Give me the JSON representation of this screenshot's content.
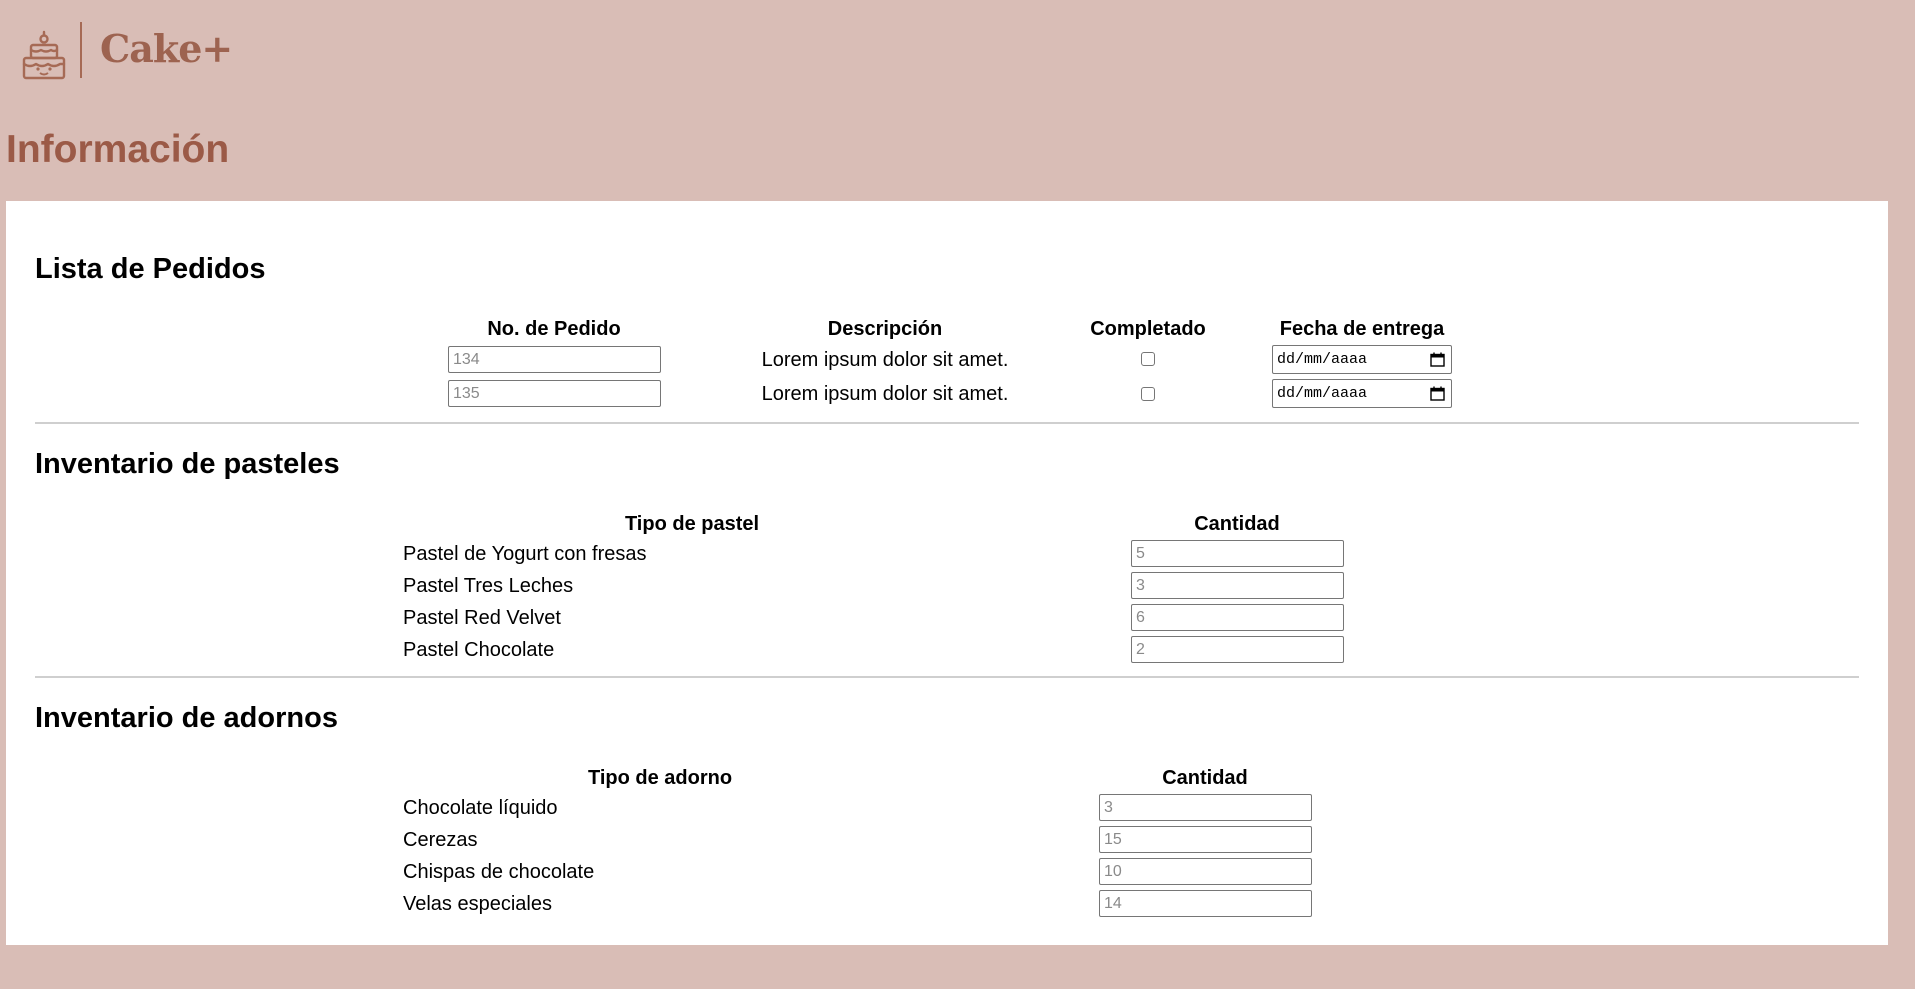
{
  "brand": {
    "name": "Cake+"
  },
  "page": {
    "title": "Información"
  },
  "orders": {
    "title": "Lista de Pedidos",
    "headers": [
      "No. de Pedido",
      "Descripción",
      "Completado",
      "Fecha de entrega"
    ],
    "rows": [
      {
        "number_placeholder": "134",
        "description": "Lorem ipsum dolor sit amet.",
        "completed": false,
        "date_placeholder": "dd/mm/aaaa"
      },
      {
        "number_placeholder": "135",
        "description": "Lorem ipsum dolor sit amet.",
        "completed": false,
        "date_placeholder": "dd/mm/aaaa"
      }
    ]
  },
  "cakes": {
    "title": "Inventario de pasteles",
    "headers": [
      "Tipo de pastel",
      "Cantidad"
    ],
    "rows": [
      {
        "name": "Pastel de Yogurt con fresas",
        "qty_placeholder": "5"
      },
      {
        "name": "Pastel Tres Leches",
        "qty_placeholder": "3"
      },
      {
        "name": "Pastel Red Velvet",
        "qty_placeholder": "6"
      },
      {
        "name": "Pastel Chocolate",
        "qty_placeholder": "2"
      }
    ]
  },
  "decorations": {
    "title": "Inventario de adornos",
    "headers": [
      "Tipo de adorno",
      "Cantidad"
    ],
    "rows": [
      {
        "name": "Chocolate líquido",
        "qty_placeholder": "3"
      },
      {
        "name": "Cerezas",
        "qty_placeholder": "15"
      },
      {
        "name": "Chispas de chocolate",
        "qty_placeholder": "10"
      },
      {
        "name": "Velas especiales",
        "qty_placeholder": "14"
      }
    ]
  },
  "icons": {
    "logo": "cake-icon",
    "date_picker": "calendar-icon"
  },
  "colors": {
    "background": "#d9bdb6",
    "brand": "#9d6350",
    "panel": "#ffffff"
  }
}
